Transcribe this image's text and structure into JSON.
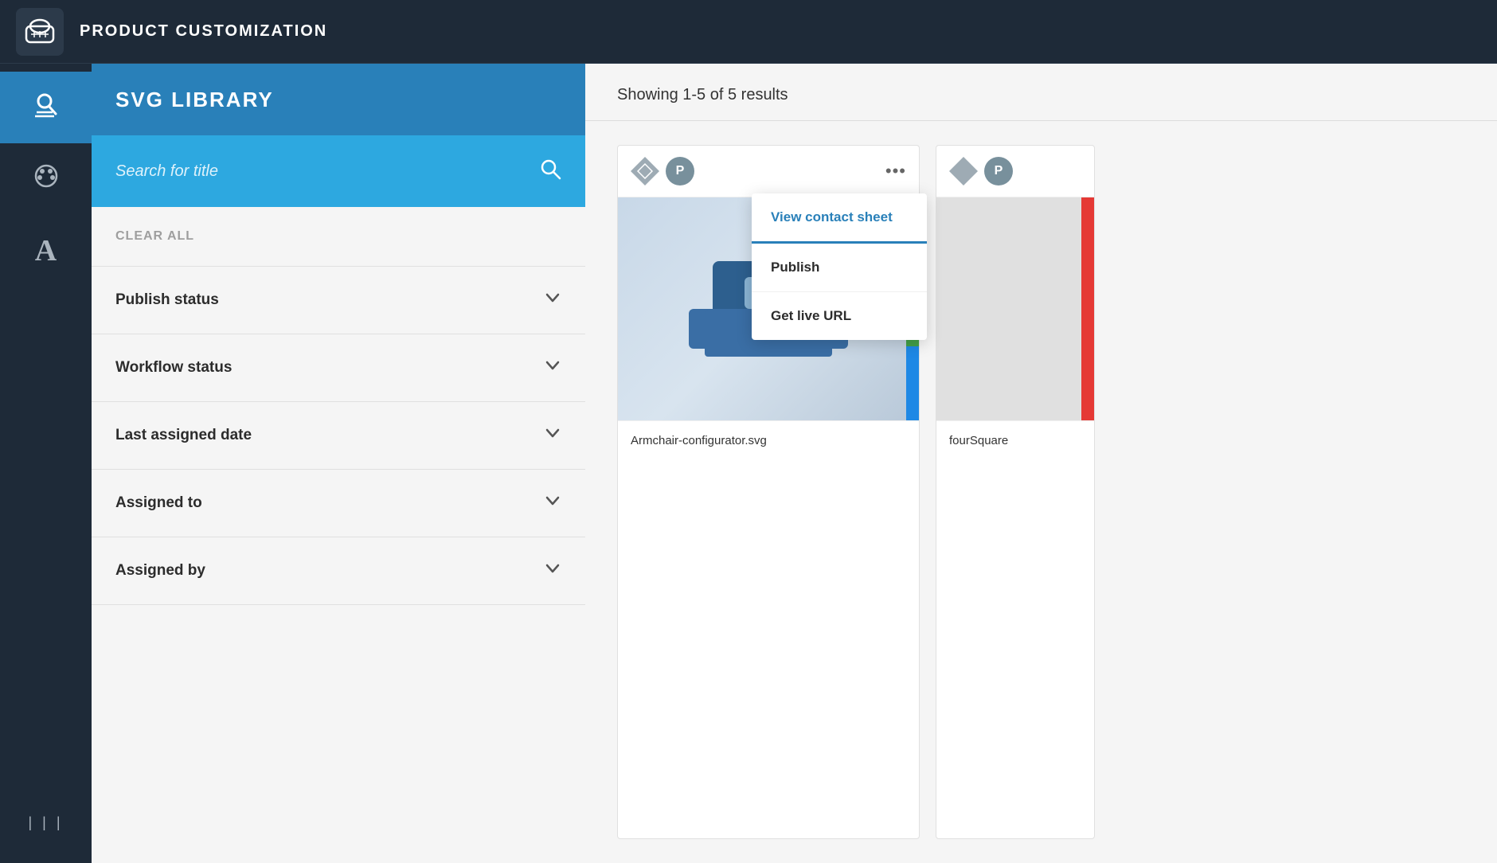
{
  "header": {
    "logo_icon": "👟",
    "title": "PRODUCT CUSTOMIZATION"
  },
  "sidebar": {
    "items": [
      {
        "id": "library",
        "icon": "🔍",
        "active": true
      },
      {
        "id": "palette",
        "icon": "🎨",
        "active": false
      },
      {
        "id": "font",
        "icon": "A",
        "active": false
      }
    ],
    "bars_icon": "|||"
  },
  "section": {
    "title": "SVG LIBRARY"
  },
  "search": {
    "placeholder": "Search for title"
  },
  "filter": {
    "clear_all": "CLEAR ALL",
    "rows": [
      {
        "id": "publish-status",
        "label": "Publish status"
      },
      {
        "id": "workflow-status",
        "label": "Workflow status"
      },
      {
        "id": "last-assigned-date",
        "label": "Last assigned date"
      },
      {
        "id": "assigned-to",
        "label": "Assigned to"
      },
      {
        "id": "assigned-by",
        "label": "Assigned by"
      }
    ]
  },
  "results": {
    "count_text": "Showing 1-5 of 5 results"
  },
  "cards": [
    {
      "id": "card-1",
      "filename": "Armchair-configurator.svg",
      "show_menu": true,
      "colors": [
        "red",
        "green",
        "blue"
      ]
    },
    {
      "id": "card-2",
      "filename": "fourSquare",
      "show_menu": false,
      "colors": [
        "red"
      ]
    }
  ],
  "context_menu": {
    "items": [
      {
        "id": "view-contact",
        "label": "View contact sheet",
        "active": true
      },
      {
        "id": "publish",
        "label": "Publish",
        "active": false
      },
      {
        "id": "get-live-url",
        "label": "Get live URL",
        "active": false
      }
    ]
  },
  "icons": {
    "search": "🔍",
    "chevron_down": "∨",
    "more": "•••",
    "diamond": "◇",
    "p_badge": "P"
  }
}
